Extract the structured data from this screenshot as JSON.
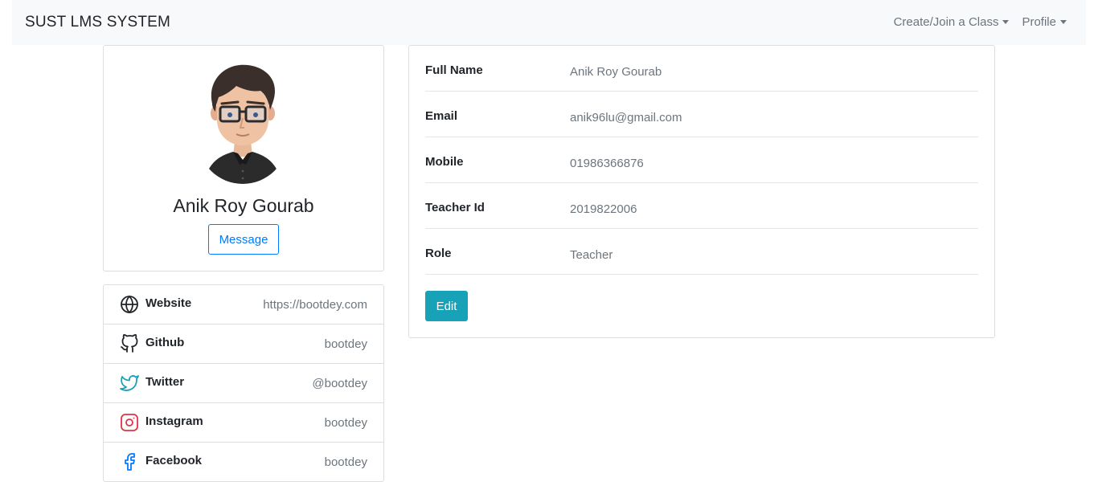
{
  "navbar": {
    "brand": "SUST LMS SYSTEM",
    "links": [
      {
        "label": "Create/Join a Class"
      },
      {
        "label": "Profile"
      }
    ]
  },
  "profile": {
    "name": "Anik Roy Gourab",
    "message_label": "Message",
    "avatar_icon": "avatar-man-glasses"
  },
  "social": [
    {
      "label": "Website",
      "value": "https://bootdey.com",
      "icon": "globe-icon",
      "color": "#212529"
    },
    {
      "label": "Github",
      "value": "bootdey",
      "icon": "github-icon",
      "color": "#212529"
    },
    {
      "label": "Twitter",
      "value": "@bootdey",
      "icon": "twitter-icon",
      "color": "#17a2b8"
    },
    {
      "label": "Instagram",
      "value": "bootdey",
      "icon": "instagram-icon",
      "color": "#dc3545"
    },
    {
      "label": "Facebook",
      "value": "bootdey",
      "icon": "facebook-icon",
      "color": "#007bff"
    }
  ],
  "details": [
    {
      "label": "Full Name",
      "value": "Anik Roy Gourab"
    },
    {
      "label": "Email",
      "value": "anik96lu@gmail.com"
    },
    {
      "label": "Mobile",
      "value": "01986366876"
    },
    {
      "label": "Teacher Id",
      "value": "2019822006"
    },
    {
      "label": "Role",
      "value": "Teacher"
    }
  ],
  "edit_label": "Edit",
  "colors": {
    "navbar_bg": "#f8f9fa",
    "primary": "#007bff",
    "info": "#17a2b8",
    "muted": "#6c757d"
  }
}
